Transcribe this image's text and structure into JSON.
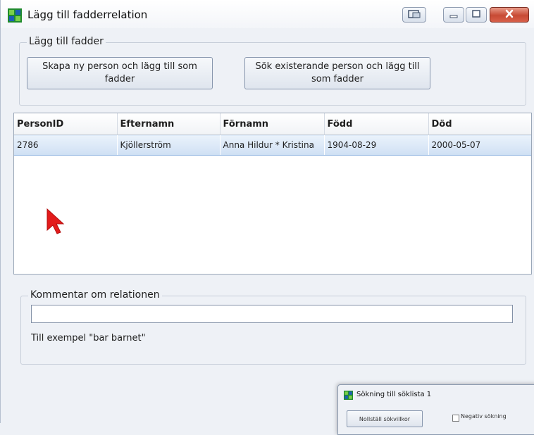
{
  "window": {
    "title": "Lägg till fadderrelation"
  },
  "fadder_group": {
    "legend": "Lägg till fadder",
    "new_person_button": "Skapa ny person och lägg till som fadder",
    "search_person_button": "Sök existerande person och lägg till som fadder"
  },
  "table": {
    "columns": [
      "PersonID",
      "Efternamn",
      "Förnamn",
      "Född",
      "Död"
    ],
    "rows": [
      [
        "2786",
        "Kjöllerström",
        "Anna Hildur * Kristina",
        "1904-08-29",
        "2000-05-07"
      ]
    ]
  },
  "comment": {
    "legend": "Kommentar om relationen",
    "value": "",
    "hint": "Till exempel \"bar barnet\""
  },
  "mini_window": {
    "title": "Sökning till söklista 1",
    "reset_button": "Nollställ sökvillkor",
    "negate_label": "Negativ sökning"
  },
  "icons": {
    "app": "app-icon",
    "cursor": "mouse-pointer-icon"
  },
  "colors": {
    "close_button": "#c74a34",
    "selected_row": "#cfe0f4",
    "cursor": "#e31b1b"
  }
}
